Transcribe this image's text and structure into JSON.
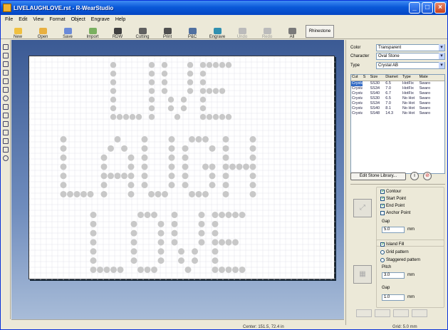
{
  "window": {
    "title": "LIVELAUGHLOVE.rst - R-WearStudio"
  },
  "menu": [
    "File",
    "Edit",
    "View",
    "Format",
    "Object",
    "Engrave",
    "Help"
  ],
  "toolbar": {
    "buttons": [
      {
        "label": "New",
        "icon": "new-file-icon",
        "color": "#f0c040",
        "enabled": true
      },
      {
        "label": "Open",
        "icon": "open-folder-icon",
        "color": "#e8b040",
        "enabled": true
      },
      {
        "label": "Save",
        "icon": "save-icon",
        "color": "#6a8ad8",
        "enabled": true
      },
      {
        "label": "Import",
        "icon": "import-icon",
        "color": "#7ab060",
        "enabled": true
      },
      {
        "label": "RDW",
        "icon": "rdw-icon",
        "color": "#404040",
        "enabled": true
      },
      {
        "label": "Cutting",
        "icon": "cutting-icon",
        "color": "#606060",
        "enabled": true
      },
      {
        "label": "Print",
        "icon": "print-icon",
        "color": "#505050",
        "enabled": true
      },
      {
        "label": "P&C",
        "icon": "print-cut-icon",
        "color": "#5070a0",
        "enabled": true
      },
      {
        "label": "Engrave",
        "icon": "engrave-icon",
        "color": "#3090b0",
        "enabled": true
      },
      {
        "label": "Undo",
        "icon": "undo-icon",
        "color": "#bbbbbb",
        "enabled": false
      },
      {
        "label": "Redo",
        "icon": "redo-icon",
        "color": "#bbbbbb",
        "enabled": false
      },
      {
        "label": "All",
        "icon": "select-all-icon",
        "color": "#7a7a7a",
        "enabled": true
      }
    ],
    "dropdown_label": "Rhinestone"
  },
  "properties": {
    "color_label": "Color",
    "color_value": "Transparent",
    "character_label": "Character",
    "character_value": "Oval Stone",
    "type_label": "Type",
    "type_value": "Crystal AB"
  },
  "font_table": {
    "headers": [
      "Cut",
      "S",
      "Size",
      "Diamet",
      "Type",
      "Mate"
    ],
    "rows": [
      [
        "Crystal",
        "",
        "SS30",
        "6.5",
        "HotFix",
        "Swaro"
      ],
      [
        "Crystal",
        "",
        "SS34",
        "7.0",
        "HotFix",
        "Swaro"
      ],
      [
        "Crystal",
        "",
        "SS40",
        "6.7",
        "HotFix",
        "Swaro"
      ],
      [
        "Crystal",
        "",
        "SS30",
        "6.5",
        "No Hot",
        "Swaro"
      ],
      [
        "Crystal",
        "",
        "SS34",
        "7.0",
        "No Hot",
        "Swaro"
      ],
      [
        "Crystal",
        "",
        "SS40",
        "8.1",
        "No Hot",
        "Swaro"
      ],
      [
        "Crystal",
        "",
        "SS48",
        "14.3",
        "No Hot",
        "Swaro"
      ]
    ]
  },
  "library": {
    "edit_label": "Edit Stone Library..."
  },
  "options": {
    "contour_label": "Contour",
    "contour_checked": true,
    "start_label": "Start Point",
    "start_checked": true,
    "end_label": "End Point",
    "end_checked": true,
    "anchor_label": "Anchor Point",
    "anchor_checked": false,
    "gap_label": "Gap",
    "gap_value": "5.0",
    "gap_unit": "mm",
    "fill_label": "Island Fill",
    "grid_label": "Grid pattern",
    "staggered_label": "Staggered pattern",
    "pitch_label": "Pitch",
    "pitch_value": "3.0",
    "pitch_unit": "mm",
    "gap2_label": "Gap",
    "gap2_value": "1.0",
    "gap2_unit": "mm",
    "selected_fill": "island"
  },
  "canvas": {
    "words": [
      "LIVE",
      "LAUGH",
      "LOVE"
    ],
    "stone_color": "#c8c8c8",
    "grid_color": "#e2e2ea"
  },
  "status": {
    "left": "Center: 151.5, 72.4 in",
    "right": "Grid: 5.0 mm"
  }
}
